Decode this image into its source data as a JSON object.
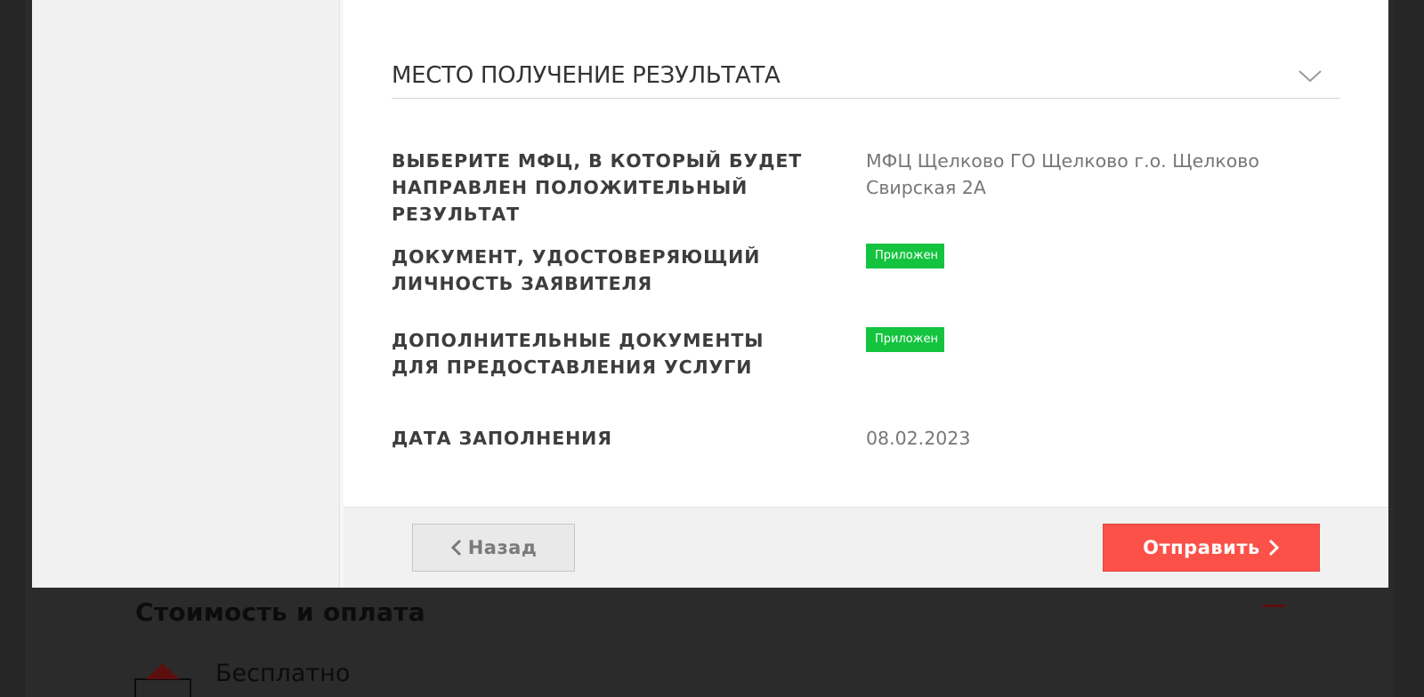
{
  "background": {
    "cost_title": "Стоимость и оплата",
    "price_label": "Бесплатно"
  },
  "modal": {
    "section_title": "МЕСТО ПОЛУЧЕНИЕ РЕЗУЛЬТАТА",
    "fields": [
      {
        "label": "ВЫБЕРИТЕ МФЦ, В КОТОРЫЙ БУДЕТ НАПРАВЛЕН ПОЛОЖИТЕЛЬНЫЙ РЕЗУЛЬТАТ",
        "value": "МФЦ Щелково ГО Щелково г.о. Щелково Свирская 2А"
      },
      {
        "label": "ДОКУМЕНТ, УДОСТОВЕРЯЮЩИЙ ЛИЧНОСТЬ ЗАЯВИТЕЛЯ",
        "badge": "Приложен"
      },
      {
        "label": "ДОПОЛНИТЕЛЬНЫЕ ДОКУМЕНТЫ ДЛЯ ПРЕДОСТАВЛЕНИЯ УСЛУГИ",
        "badge": "Приложен"
      },
      {
        "label": "ДАТА ЗАПОЛНЕНИЯ",
        "value": "08.02.2023"
      }
    ],
    "footer": {
      "back_label": "Назад",
      "submit_label": "Отправить"
    }
  },
  "icons": {
    "section_toggle": "chevron-down-icon",
    "back": "chevron-left-icon",
    "submit": "chevron-right-icon",
    "price": "wallet-icon"
  },
  "colors": {
    "accent": "#fb5148",
    "badge": "#14c43f",
    "overlay": "#2b2b2b"
  }
}
